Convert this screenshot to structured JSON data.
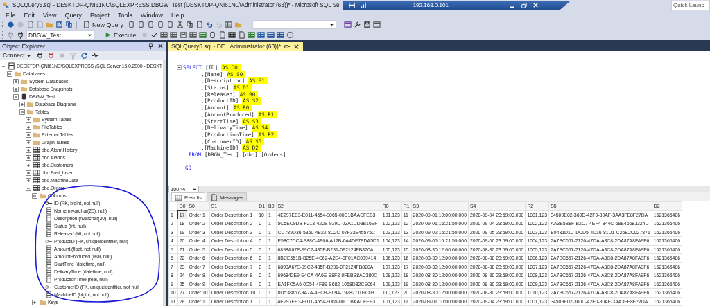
{
  "window": {
    "title": "SQLQuery5.sql - DESKTOP-QNI61NC\\SQLEXPRESS.DBGW_Test (DESKTOP-QNI61NC\\Administrator (63))* - Microsoft SQL Se",
    "remote_bar": {
      "address": "192.168.0.101"
    },
    "quick_launch": {
      "placeholder": "Quick Launc"
    }
  },
  "menu": [
    "File",
    "Edit",
    "View",
    "Query",
    "Project",
    "Tools",
    "Window",
    "Help"
  ],
  "toolbar": {
    "new_query": "New Query",
    "database": "DBGW_Test",
    "execute": "Execute"
  },
  "explorer": {
    "title": "Object Explorer",
    "connect": "Connect",
    "tree": [
      {
        "label": "DESKTOP-QNI61NC\\SQLEXPRESS (SQL Server 15.0.2000 - DESKT",
        "kind": "server",
        "expanded": true,
        "children": [
          {
            "label": "Databases",
            "kind": "folder",
            "expanded": true,
            "children": [
              {
                "label": "System Databases",
                "kind": "folder",
                "expanded": false
              },
              {
                "label": "Database Snapshots",
                "kind": "folder",
                "expanded": false
              },
              {
                "label": "DBGW_Test",
                "kind": "database",
                "expanded": true,
                "children": [
                  {
                    "label": "Database Diagrams",
                    "kind": "folder",
                    "expanded": false
                  },
                  {
                    "label": "Tables",
                    "kind": "folder",
                    "expanded": true,
                    "children": [
                      {
                        "label": "System Tables",
                        "kind": "folder",
                        "expanded": false
                      },
                      {
                        "label": "FileTables",
                        "kind": "folder",
                        "expanded": false
                      },
                      {
                        "label": "External Tables",
                        "kind": "folder",
                        "expanded": false
                      },
                      {
                        "label": "Graph Tables",
                        "kind": "folder",
                        "expanded": false
                      },
                      {
                        "label": "dbo.AlarmHistory",
                        "kind": "table",
                        "expanded": false
                      },
                      {
                        "label": "dbo.Alarms",
                        "kind": "table",
                        "expanded": false
                      },
                      {
                        "label": "dbo.Customers",
                        "kind": "table",
                        "expanded": false
                      },
                      {
                        "label": "dbo.Fast_Insert",
                        "kind": "table",
                        "expanded": false
                      },
                      {
                        "label": "dbo.MachineData",
                        "kind": "table",
                        "expanded": false
                      },
                      {
                        "label": "dbo.Orders",
                        "kind": "table",
                        "expanded": true,
                        "children": [
                          {
                            "label": "Columns",
                            "kind": "folder",
                            "expanded": true,
                            "children": [
                              {
                                "label": "ID (PK, bigint, not null)",
                                "kind": "primary-key"
                              },
                              {
                                "label": "Name (nvarchar(20), null)",
                                "kind": "column"
                              },
                              {
                                "label": "Description (nvarchar(30), null)",
                                "kind": "column"
                              },
                              {
                                "label": "Status (int, null)",
                                "kind": "column"
                              },
                              {
                                "label": "Released (bit, not null)",
                                "kind": "column"
                              },
                              {
                                "label": "ProductID (FK, uniqueidentifier, null)",
                                "kind": "foreign-key"
                              },
                              {
                                "label": "Amount (float, not null)",
                                "kind": "column"
                              },
                              {
                                "label": "AmountProduced (real, null)",
                                "kind": "column"
                              },
                              {
                                "label": "StartTime (datetime, null)",
                                "kind": "column"
                              },
                              {
                                "label": "DelivaryTime (datetime, null)",
                                "kind": "column"
                              },
                              {
                                "label": "ProductionTime (real, null)",
                                "kind": "column"
                              },
                              {
                                "label": "CustomerID (FK, uniqueidentifier, not null",
                                "kind": "foreign-key"
                              },
                              {
                                "label": "MachineID (bigint, not null)",
                                "kind": "column"
                              }
                            ]
                          },
                          {
                            "label": "Keys",
                            "kind": "folder",
                            "expanded": false
                          }
                        ]
                      }
                    ]
                  }
                ]
              }
            ]
          }
        ]
      }
    ]
  },
  "editor": {
    "tab": "SQLQuery5.sql - DE...Administrator (63))*",
    "lines": [
      {
        "kind": "blank"
      },
      {
        "kind": "select",
        "keyword": "SELECT",
        "code": "[ID]",
        "alias": "AS D0"
      },
      {
        "kind": "column",
        "code": ",[Name]",
        "alias": "AS S0"
      },
      {
        "kind": "column",
        "code": ",[Description]",
        "alias": "AS S1"
      },
      {
        "kind": "column",
        "code": ",[Status]",
        "alias": "AS D1"
      },
      {
        "kind": "column",
        "code": ",[Released]",
        "alias": "AS B0"
      },
      {
        "kind": "column",
        "code": ",[ProductID]",
        "alias": "AS S2"
      },
      {
        "kind": "column",
        "code": ",[Amount]",
        "alias": "AS R0"
      },
      {
        "kind": "column",
        "code": ",[AmountProduced]",
        "alias": "AS R1"
      },
      {
        "kind": "column",
        "code": ",[StartTime]",
        "alias": "AS S3"
      },
      {
        "kind": "column",
        "code": ",[DelivaryTime]",
        "alias": "AS S4"
      },
      {
        "kind": "column",
        "code": ",[ProductionTime]",
        "alias": "AS R2"
      },
      {
        "kind": "column",
        "code": ",[CustomerID]",
        "alias": "AS S5"
      },
      {
        "kind": "column",
        "code": ",[MachineID]",
        "alias": "AS D2"
      },
      {
        "kind": "from",
        "keyword": "FROM",
        "code": "[DBGW_Test].[dbo].[Orders]"
      },
      {
        "kind": "blank"
      },
      {
        "kind": "go",
        "keyword": "GO"
      }
    ]
  },
  "results": {
    "zoom": "100 %",
    "tabs": [
      {
        "label": "Results",
        "selected": true
      },
      {
        "label": "Messages",
        "selected": false
      }
    ],
    "columns": [
      "",
      "D0",
      "S0",
      "S1",
      "D1",
      "B0",
      "S2",
      "R0",
      "R1",
      "S3",
      "S4",
      "R2",
      "S5",
      "D2"
    ],
    "rows": [
      [
        "1",
        "17",
        "Order 1",
        "Order Description 1",
        "10",
        "1",
        "4E297EE3-E011-4554-9065-00C1BAACFEB3",
        "101,123",
        "11",
        "2020-09-01 10:00:00.000",
        "2020-09-04 23:59:00.000",
        "1001,123",
        "34509E02-360D-42F0-80AF-3AA3FE8F27DA",
        "1621365406"
      ],
      [
        "2",
        "18",
        "Order 2",
        "Order Description 2",
        "0",
        "1",
        "5C5EC9DB-F213-420B-939D-03A1CD3B16EF",
        "102,123",
        "12",
        "2020-09-01 16:21:59.000",
        "2020-09-04 23:59:00.000",
        "1002,123",
        "AA3B5B8F-B2C7-4EF4-844C-68E46681324D",
        "1621365406"
      ],
      [
        "3",
        "19",
        "Order 3",
        "Order Description 3",
        "0",
        "1",
        "CC789D36-5360-4B22-8C2C-07F33E45575C",
        "103,123",
        "13",
        "2020-09-02 16:21:59.000",
        "2020-09-05 23:59:00.000",
        "1003,123",
        "B9431D1C-DCD5-4D16-81D1-C26E2C027871",
        "1621365406"
      ],
      [
        "4",
        "20",
        "Order 4",
        "Order Description 4",
        "0",
        "1",
        "E58C7CC4-E88C-4E06-A17B-0A4DF7EDA5D1",
        "104,123",
        "14",
        "2020-09-05 16:21:59.000",
        "2020-09-06 23:59:00.000",
        "1004,123",
        "2A7BC657-2126-47DA-A3C8-2DA87A8FA9F6",
        "1621365406"
      ],
      [
        "5",
        "21",
        "Order 5",
        "Order Description 5",
        "0",
        "1",
        "6898A67E-99C2-435F-B231-0F2124FB820A",
        "105,123",
        "15",
        "2020-08-30 12:00:00.000",
        "2020-08-30 23:59:00.000",
        "1005,123",
        "2A7BC657-2126-47DA-A3C8-2DA87A8FA9F6",
        "1621365406"
      ],
      [
        "6",
        "22",
        "Order 6",
        "Order Description 6",
        "0",
        "1",
        "8BCE551B-B25E-4C62-A2E4-0F01AC099414",
        "106,123",
        "16",
        "2020-08-30 12:00:00.000",
        "2020-08-30 23:59:00.000",
        "1006,123",
        "2A7BC657-2126-47DA-A3C8-2DA87A8FA9F6",
        "1621365406"
      ],
      [
        "7",
        "23",
        "Order 7",
        "Order Description 7",
        "0",
        "1",
        "6898A67E-99C2-435F-B231-0F2124FB820A",
        "107,123",
        "17",
        "2020-08-30 12:00:00.000",
        "2020-08-30 23:59:00.000",
        "1007,123",
        "2A7BC657-2126-47DA-A3C8-2DA87A8FA9F6",
        "1621365406"
      ],
      [
        "8",
        "24",
        "Order 8",
        "Order Description 8",
        "0",
        "1",
        "696842E9-E4CA-4A6E-B8F3-0FEBB8AC380C",
        "108,123",
        "18",
        "2020-08-30 12:00:00.000",
        "2020-08-30 23:59:00.000",
        "1008,123",
        "2A7BC657-2126-47DA-A3C8-2DA87A8FA9F6",
        "1621365406"
      ],
      [
        "9",
        "25",
        "Order 9",
        "Order Description 9",
        "0",
        "1",
        "EA1FC5A6-0C54-4F89-B682-1068D82CE064",
        "109,123",
        "19",
        "2020-08-30 12:00:00.000",
        "2020-08-30 23:59:00.000",
        "1009,123",
        "2A7BC657-2126-47DA-A3C8-2DA87A8FA9F6",
        "1621365406"
      ],
      [
        "10",
        "27",
        "Order 10",
        "Order Description 10",
        "0",
        "1",
        "8D538867-9A7A-4ECB-B094-192827109C08",
        "110,123",
        "20",
        "2020-08-30 12:00:00.000",
        "2020-08-30 23:59:00.000",
        "1010,123",
        "2A7BC657-2126-47DA-A3C8-2DA87A8FA9F6",
        "1621365406"
      ],
      [
        "11",
        "28",
        "Order 1",
        "Order Description 1",
        "0",
        "1",
        "4E297EE3-E011-4554-9065-00C1BAACFEB3",
        "101,123",
        "11",
        "2020-09-01 10:00:00.000",
        "2020-09-04 23:59:00.000",
        "1001,123",
        "34509E02-360D-42F0-80AF-3AA3FE8F27DA",
        "1621365406"
      ]
    ]
  }
}
